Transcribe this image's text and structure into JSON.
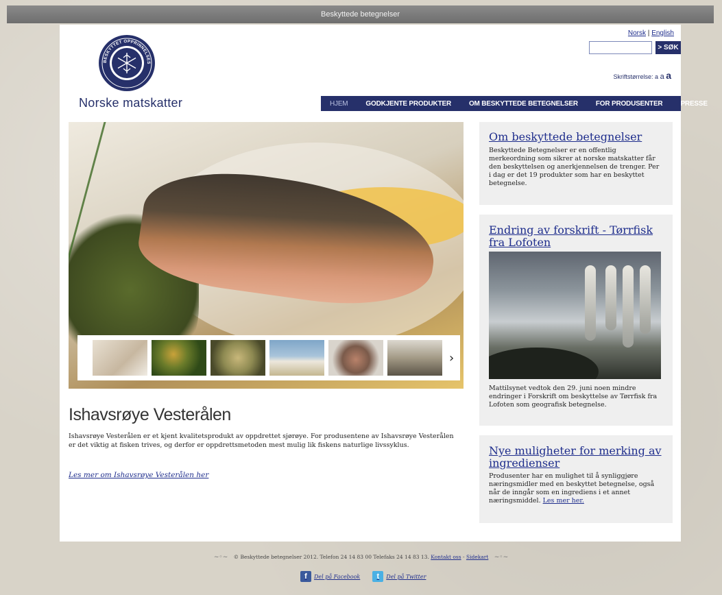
{
  "window": {
    "title": "Beskyttede betegnelser"
  },
  "header": {
    "logo_seal_text": "BESKYTTET OPPRINNELSESBETEGNELSE",
    "logo_text": "Norske matskatter",
    "lang_norsk": "Norsk",
    "lang_sep": "|",
    "lang_english": "English",
    "search_placeholder": "",
    "search_button": "> SØK",
    "fontsize_label": "Skriftstørrelse:",
    "fontsize_options": [
      "a",
      "a",
      "a"
    ]
  },
  "nav": {
    "items": [
      {
        "label": "HJEM"
      },
      {
        "label": "GODKJENTE PRODUKTER"
      },
      {
        "label": "OM BESKYTTEDE BETEGNELSER"
      },
      {
        "label": "FOR PRODUSENTER"
      },
      {
        "label": "PRESSE"
      }
    ]
  },
  "hero": {
    "thumb_arrow": "›"
  },
  "article": {
    "title": "Ishavsrøye Vesterålen",
    "body": "Ishavsrøye Vesterålen er et kjent kvalitetsprodukt av oppdrettet sjørøye. For produsentene av Ishavsrøye Vesterålen er det viktig at fisken trives, og derfor er oppdrettsmetoden mest mulig lik fiskens naturlige livssyklus.",
    "link": "Les mer om Ishavsrøye Vesterålen her"
  },
  "sidebar": {
    "box1": {
      "title": "Om beskyttede betegnelser",
      "body": "Beskyttede Betegnelser er en offentlig merkeordning som sikrer at norske matskatter får den beskyttelsen og anerkjennelsen de trenger. Per i dag er det 19 produkter som har en beskyttet betegnelse."
    },
    "box2": {
      "title": "Endring av forskrift - Tørrfisk fra Lofoten",
      "body": "Mattilsynet vedtok den 29. juni noen mindre endringer i Forskrift om beskyttelse av Tørrfisk fra Lofoten som geografisk betegnelse."
    },
    "box3": {
      "title": "Nye muligheter for merking av ingredienser",
      "body": "Produsenter har en mulighet til å synliggjøre næringsmidler med en beskyttet betegnelse, også når de inngår som en ingrediens i et annet næringsmiddel.",
      "link": "Les mer her."
    }
  },
  "footer": {
    "copyright": "© Beskyttede betegnelser 2012. Telefon 24 14 83 00 Telefaks 24 14 83 13.",
    "contact": "Kontakt oss",
    "sep": "-",
    "sitemap": "Sidekart",
    "share_facebook": "Del på Facebook",
    "share_twitter": "Del på Twitter"
  },
  "colors": {
    "brand": "#26306a",
    "link": "#1e2d8c",
    "box_bg": "#efefef"
  }
}
